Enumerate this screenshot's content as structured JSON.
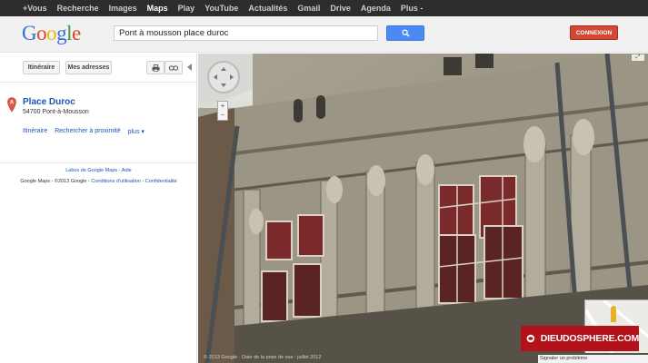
{
  "topnav": {
    "items": [
      "+Vous",
      "Recherche",
      "Images",
      "Maps",
      "Play",
      "YouTube",
      "Actualités",
      "Gmail",
      "Drive",
      "Agenda",
      "Plus -"
    ],
    "active": "Maps"
  },
  "header": {
    "logo": "Google",
    "search_value": "Pont à mousson place duroc",
    "login_label": "CONNEXION"
  },
  "left_panel": {
    "toolbar": {
      "itinerary_label": "Itinéraire",
      "my_addresses_label": "Mes adresses"
    },
    "place": {
      "marker": "A",
      "title": "Place Duroc",
      "address": "54700 Pont-à-Mousson"
    },
    "links": {
      "itinerary": "Itinéraire",
      "nearby": "Rechercher à proximité",
      "more": "plus ▾"
    },
    "footer": {
      "labs": "Labos de Google Maps",
      "sep": "-",
      "help": "Aide",
      "copyright": "Google Maps - ©2013 Google -",
      "terms": "Conditions d'utilisation",
      "privacy": "Confidentialité"
    }
  },
  "streetview": {
    "copyright": "© 2013 Google · Date de la prise de vue : juillet 2012",
    "report": "Signaler un problème",
    "watermark": "DIEUDOSPHERE.COM"
  },
  "colors": {
    "accent_red": "#d14836",
    "search_blue": "#4a8af4",
    "link_blue": "#1a54b7",
    "watermark_red": "#b3121b"
  }
}
